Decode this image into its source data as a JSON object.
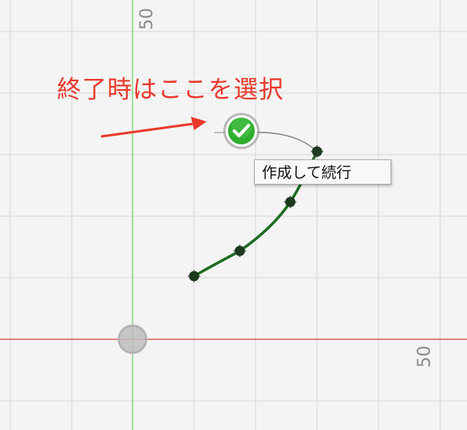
{
  "viewport": {
    "axis_label_top": "50",
    "axis_label_right": "50"
  },
  "instruction": {
    "text": "終了時はここを選択"
  },
  "tooltip": {
    "text": "作成して続行"
  },
  "icons": {
    "finish": "check-circle-icon",
    "origin": "origin-icon"
  },
  "colors": {
    "spline": "#1e6b22",
    "finish_green": "#2fae2f",
    "annotation_red": "#e8392c",
    "x_axis": "#e05a5a",
    "y_axis": "#7ed87e",
    "grid": "#d6d6d6"
  }
}
